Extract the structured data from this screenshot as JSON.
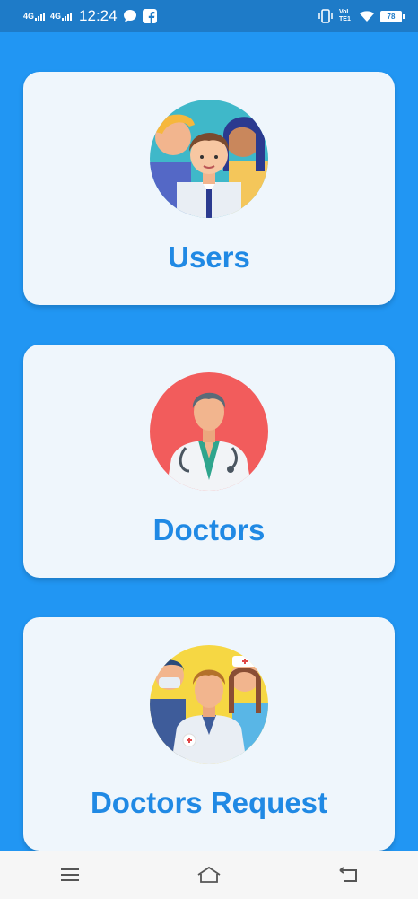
{
  "status_bar": {
    "network1": "4G",
    "network2": "4G",
    "time": "12:24",
    "volte": "VoLTE1",
    "battery": "78"
  },
  "cards": [
    {
      "label": "Users",
      "icon": "users-group-icon"
    },
    {
      "label": "Doctors",
      "icon": "doctor-icon"
    },
    {
      "label": "Doctors Request",
      "icon": "medical-team-icon"
    }
  ],
  "nav": {
    "menu_icon": "menu-icon",
    "home_icon": "home-icon",
    "back_icon": "back-icon"
  },
  "colors": {
    "background": "#2196F3",
    "status_bar": "#1E7BC8",
    "card": "#EFF6FC",
    "label": "#2089E4"
  }
}
